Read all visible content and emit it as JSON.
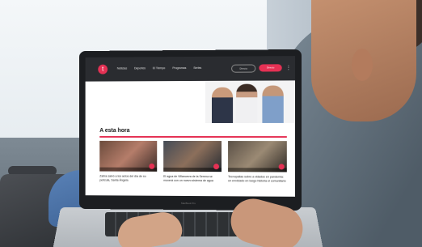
{
  "site": {
    "logo_letter": "t",
    "nav": [
      "Noticias",
      "Deportes",
      "El Tiempo",
      "Programas",
      "Series"
    ],
    "button_outline": "Directo",
    "button_live": "Directo",
    "menu_icon": "more-vertical-icon"
  },
  "section": {
    "title": "A esta hora"
  },
  "cards": [
    {
      "title": "Zahía salvó a los actos del día de su película, Santa Ángela"
    },
    {
      "title": "El agua de Villanueva de la Serena se moverá con un nuevo sistema de agua"
    },
    {
      "title": "Tecnopalias sobre a vidados en pandemia: un enviciado en luego historia el comunitario"
    }
  ],
  "laptop": {
    "brand_text": "MacBook Pro"
  },
  "colors": {
    "accent": "#e53154",
    "topbar": "#2a2c30"
  }
}
